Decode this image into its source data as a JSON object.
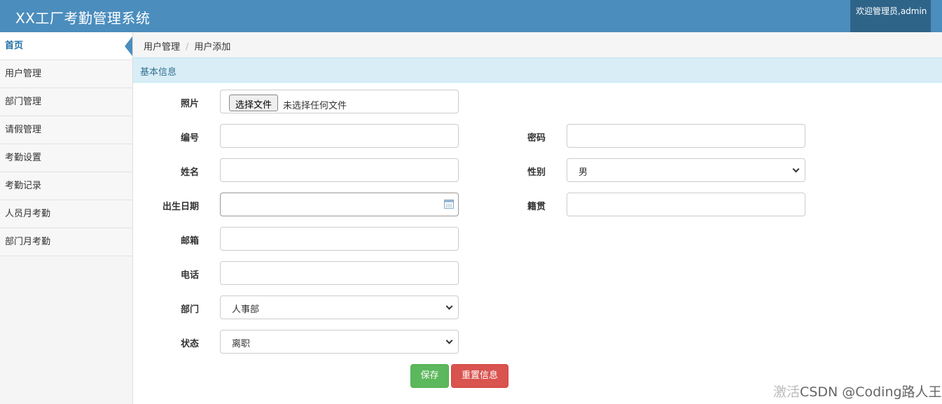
{
  "header": {
    "title": "XX工厂考勤管理系统",
    "welcome": "欢迎管理员,admin",
    "colors": {
      "header_bg": "#4b8dbd",
      "welcome_bg": "#2f6489"
    }
  },
  "sidebar": {
    "items": [
      {
        "label": "首页",
        "active": true
      },
      {
        "label": "用户管理"
      },
      {
        "label": "部门管理"
      },
      {
        "label": "请假管理"
      },
      {
        "label": "考勤设置"
      },
      {
        "label": "考勤记录"
      },
      {
        "label": "人员月考勤"
      },
      {
        "label": "部门月考勤"
      }
    ]
  },
  "breadcrumb": {
    "parent": "用户管理",
    "current": "用户添加"
  },
  "panel": {
    "heading": "基本信息"
  },
  "form": {
    "photo": {
      "label": "照片",
      "button": "选择文件",
      "status": "未选择任何文件"
    },
    "number": {
      "label": "编号",
      "value": ""
    },
    "password": {
      "label": "密码",
      "value": ""
    },
    "name": {
      "label": "姓名",
      "value": ""
    },
    "gender": {
      "label": "性别",
      "value": "男"
    },
    "birthdate": {
      "label": "出生日期",
      "value": ""
    },
    "native_place": {
      "label": "籍贯",
      "value": ""
    },
    "email": {
      "label": "邮箱",
      "value": ""
    },
    "phone": {
      "label": "电话",
      "value": ""
    },
    "department": {
      "label": "部门",
      "value": "人事部"
    },
    "status": {
      "label": "状态",
      "value": "离职"
    }
  },
  "actions": {
    "save": "保存",
    "reset": "重置信息",
    "colors": {
      "save": "#5cb85c",
      "reset": "#d9534f"
    }
  },
  "watermark": {
    "prefix": "激活",
    "text": "CSDN @Coding路人王"
  }
}
